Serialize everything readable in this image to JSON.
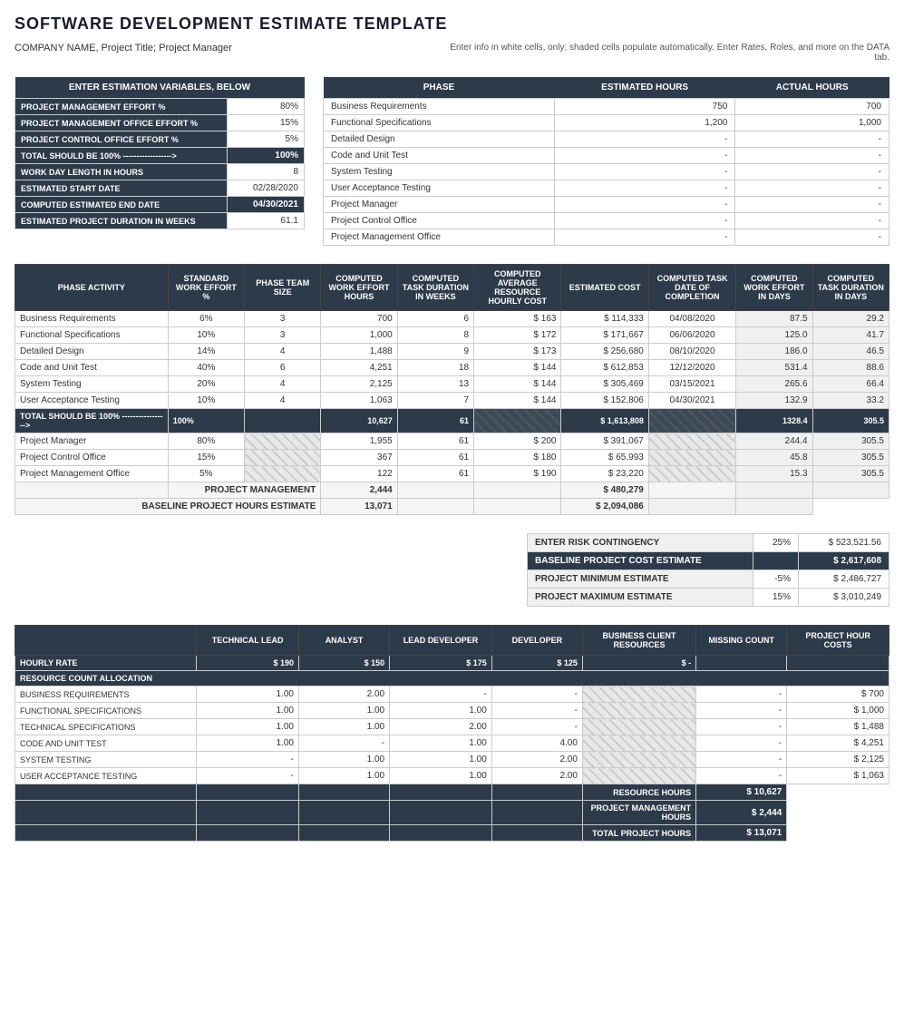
{
  "title": "SOFTWARE DEVELOPMENT ESTIMATE TEMPLATE",
  "subtitle": {
    "left": "COMPANY NAME, Project Title; Project Manager",
    "right": "Enter info in white cells, only; shaded cells populate automatically.  Enter Rates, Roles, and more on the DATA tab."
  },
  "vars": {
    "header": "ENTER ESTIMATION VARIABLES, BELOW",
    "rows": [
      {
        "label": "PROJECT MANAGEMENT EFFORT %",
        "value": "80%"
      },
      {
        "label": "PROJECT MANAGEMENT OFFICE EFFORT %",
        "value": "15%"
      },
      {
        "label": "PROJECT CONTROL OFFICE EFFORT %",
        "value": "5%"
      },
      {
        "label": "TOTAL SHOULD BE 100% ------------------>",
        "value": "100%",
        "dark": true
      },
      {
        "label": "WORK DAY LENGTH IN HOURS",
        "value": "8"
      },
      {
        "label": "ESTIMATED START DATE",
        "value": "02/28/2020"
      },
      {
        "label": "COMPUTED ESTIMATED END DATE",
        "value": "04/30/2021",
        "accent": true
      },
      {
        "label": "ESTIMATED PROJECT DURATION IN WEEKS",
        "value": "61.1"
      }
    ]
  },
  "phase": {
    "col1": "PHASE",
    "col2": "ESTIMATED HOURS",
    "col3": "ACTUAL HOURS",
    "rows": [
      {
        "phase": "Business Requirements",
        "estimated": "750",
        "actual": "700"
      },
      {
        "phase": "Functional Specifications",
        "estimated": "1,200",
        "actual": "1,000"
      },
      {
        "phase": "Detailed Design",
        "estimated": "-",
        "actual": "-"
      },
      {
        "phase": "Code and Unit Test",
        "estimated": "-",
        "actual": "-"
      },
      {
        "phase": "System Testing",
        "estimated": "-",
        "actual": "-"
      },
      {
        "phase": "User Acceptance Testing",
        "estimated": "-",
        "actual": "-"
      },
      {
        "phase": "Project Manager",
        "estimated": "-",
        "actual": "-"
      },
      {
        "phase": "Project Control Office",
        "estimated": "-",
        "actual": "-"
      },
      {
        "phase": "Project Management Office",
        "estimated": "-",
        "actual": "-"
      }
    ]
  },
  "estimation": {
    "headers": [
      "PHASE ACTIVITY",
      "STANDARD WORK EFFORT %",
      "PHASE TEAM SIZE",
      "COMPUTED WORK EFFORT HOURS",
      "COMPUTED TASK DURATION IN WEEKS",
      "COMPUTED AVERAGE RESOURCE HOURLY COST",
      "ESTIMATED COST",
      "COMPUTED TASK DATE OF COMPLETION",
      "COMPUTED WORK EFFORT IN DAYS",
      "COMPUTED TASK DURATION IN DAYS"
    ],
    "rows": [
      {
        "activity": "Business Requirements",
        "effort": "6%",
        "teamSize": "3",
        "workHours": "700",
        "taskDuration": "6",
        "avgCost": "$ 163",
        "estCost": "$ 114,333",
        "taskDate": "04/08/2020",
        "workDays": "87.5",
        "taskDays": "29.2"
      },
      {
        "activity": "Functional Specifications",
        "effort": "10%",
        "teamSize": "3",
        "workHours": "1,000",
        "taskDuration": "8",
        "avgCost": "$ 172",
        "estCost": "$ 171,667",
        "taskDate": "06/06/2020",
        "workDays": "125.0",
        "taskDays": "41.7"
      },
      {
        "activity": "Detailed Design",
        "effort": "14%",
        "teamSize": "4",
        "workHours": "1,488",
        "taskDuration": "9",
        "avgCost": "$ 173",
        "estCost": "$ 256,680",
        "taskDate": "08/10/2020",
        "workDays": "186.0",
        "taskDays": "46.5"
      },
      {
        "activity": "Code and Unit Test",
        "effort": "40%",
        "teamSize": "6",
        "workHours": "4,251",
        "taskDuration": "18",
        "avgCost": "$ 144",
        "estCost": "$ 612,853",
        "taskDate": "12/12/2020",
        "workDays": "531.4",
        "taskDays": "88.6"
      },
      {
        "activity": "System Testing",
        "effort": "20%",
        "teamSize": "4",
        "workHours": "2,125",
        "taskDuration": "13",
        "avgCost": "$ 144",
        "estCost": "$ 305,469",
        "taskDate": "03/15/2021",
        "workDays": "265.6",
        "taskDays": "66.4"
      },
      {
        "activity": "User Acceptance Testing",
        "effort": "10%",
        "teamSize": "4",
        "workHours": "1,063",
        "taskDuration": "7",
        "avgCost": "$ 144",
        "estCost": "$ 152,806",
        "taskDate": "04/30/2021",
        "workDays": "132.9",
        "taskDays": "33.2"
      }
    ],
    "total": {
      "label": "TOTAL SHOULD BE 100% ----------------->",
      "effort": "100%",
      "workHours": "10,627",
      "taskDuration": "61",
      "estCost": "$ 1,613,808",
      "workDays": "1328.4",
      "taskDays": "305.5"
    },
    "mgmt": [
      {
        "activity": "Project Manager",
        "effort": "80%",
        "workHours": "1,955",
        "taskDuration": "61",
        "avgCost": "$ 200",
        "estCost": "$ 391,067",
        "workDays": "244.4",
        "taskDays": "305.5"
      },
      {
        "activity": "Project Control Office",
        "effort": "15%",
        "workHours": "367",
        "taskDuration": "61",
        "avgCost": "$ 180",
        "estCost": "$ 65,993",
        "workDays": "45.8",
        "taskDays": "305.5"
      },
      {
        "activity": "Project Management Office",
        "effort": "5%",
        "workHours": "122",
        "taskDuration": "61",
        "avgCost": "$ 190",
        "estCost": "$ 23,220",
        "workDays": "15.3",
        "taskDays": "305.5"
      }
    ],
    "pmTotal": {
      "label": "PROJECT MANAGEMENT",
      "workHours": "2,444",
      "estCost": "$ 480,279"
    },
    "baseline": {
      "label": "BASELINE PROJECT HOURS ESTIMATE",
      "workHours": "13,071",
      "estCost": "$ 2,094,086"
    }
  },
  "risk": {
    "rows": [
      {
        "label": "ENTER RISK CONTINGENCY",
        "pct": "25%",
        "value": "$ 523,521.56",
        "dark": false
      },
      {
        "label": "BASELINE PROJECT COST ESTIMATE",
        "pct": "",
        "value": "$ 2,617,608",
        "dark": true
      },
      {
        "label": "PROJECT MINIMUM ESTIMATE",
        "pct": "-5%",
        "value": "$ 2,486,727",
        "dark": false
      },
      {
        "label": "PROJECT MAXIMUM ESTIMATE",
        "pct": "15%",
        "value": "$ 3,010,249",
        "dark": false
      }
    ]
  },
  "resources": {
    "headers": [
      "TECHNICAL LEAD",
      "ANALYST",
      "LEAD DEVELOPER",
      "DEVELOPER",
      "BUSINESS CLIENT RESOURCES",
      "MISSING COUNT",
      "PROJECT HOUR COSTS"
    ],
    "hourlyRates": {
      "label": "HOURLY RATE",
      "values": [
        "$ 190",
        "$ 150",
        "$ 175",
        "$ 125",
        "$ -",
        "",
        ""
      ]
    },
    "allocationHeader": "RESOURCE COUNT ALLOCATION",
    "rows": [
      {
        "activity": "BUSINESS REQUIREMENTS",
        "values": [
          "1.00",
          "2.00",
          "-",
          "-",
          "-",
          "-",
          "$ 700"
        ]
      },
      {
        "activity": "FUNCTIONAL SPECIFICATIONS",
        "values": [
          "1.00",
          "1.00",
          "1.00",
          "-",
          "-",
          "-",
          "$ 1,000"
        ]
      },
      {
        "activity": "TECHNICAL SPECIFICATIONS",
        "values": [
          "1.00",
          "1.00",
          "2.00",
          "-",
          "-",
          "-",
          "$ 1,488"
        ]
      },
      {
        "activity": "CODE AND UNIT TEST",
        "values": [
          "1.00",
          "-",
          "1.00",
          "4.00",
          "-",
          "-",
          "$ 4,251"
        ]
      },
      {
        "activity": "SYSTEM TESTING",
        "values": [
          "-",
          "1.00",
          "1.00",
          "2.00",
          "-",
          "-",
          "$ 2,125"
        ]
      },
      {
        "activity": "USER ACCEPTANCE TESTING",
        "values": [
          "-",
          "1.00",
          "1.00",
          "2.00",
          "-",
          "-",
          "$ 1,063"
        ]
      }
    ],
    "totals": [
      {
        "label": "RESOURCE HOURS",
        "value": "$ 10,627"
      },
      {
        "label": "PROJECT MANAGEMENT HOURS",
        "value": "$ 2,444"
      },
      {
        "label": "TOTAL PROJECT HOURS",
        "value": "$ 13,071"
      }
    ]
  }
}
